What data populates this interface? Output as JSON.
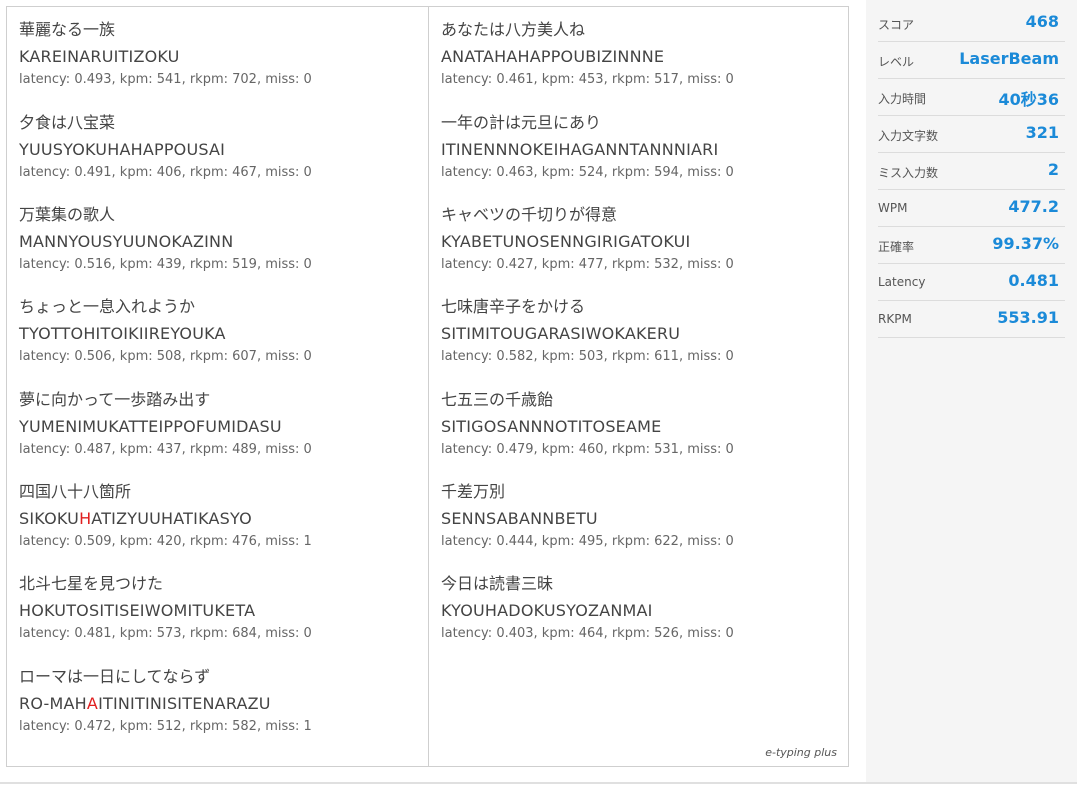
{
  "brand": "e-typing plus",
  "entries_left": [
    {
      "japanese": "華麗なる一族",
      "romaji": "KAREINARUITIZOKU",
      "stats": "latency: 0.493, kpm: 541, rkpm: 702, miss: 0"
    },
    {
      "japanese": "夕食は八宝菜",
      "romaji": "YUUSYOKUHAHAPPOUSAI",
      "stats": "latency: 0.491, kpm: 406, rkpm: 467, miss: 0"
    },
    {
      "japanese": "万葉集の歌人",
      "romaji": "MANNYOUSYUUNOKAZINN",
      "stats": "latency: 0.516, kpm: 439, rkpm: 519, miss: 0"
    },
    {
      "japanese": "ちょっと一息入れようか",
      "romaji": "TYOTTOHITOIKIIREYOUKA",
      "stats": "latency: 0.506, kpm: 508, rkpm: 607, miss: 0"
    },
    {
      "japanese": "夢に向かって一歩踏み出す",
      "romaji": "YUMENIMUKATTEIPPOFUMIDASU",
      "stats": "latency: 0.487, kpm: 437, rkpm: 489, miss: 0"
    },
    {
      "japanese": "四国八十八箇所",
      "romaji_pre": "SIKOKU",
      "romaji_miss": "H",
      "romaji_post": "ATIZYUUHATIKASYO",
      "stats": "latency: 0.509, kpm: 420, rkpm: 476, miss: 1"
    },
    {
      "japanese": "北斗七星を見つけた",
      "romaji": "HOKUTOSITISEIWOMITUKETA",
      "stats": "latency: 0.481, kpm: 573, rkpm: 684, miss: 0"
    },
    {
      "japanese": "ローマは一日にしてならず",
      "romaji_pre": "RO-MAH",
      "romaji_miss": "A",
      "romaji_post": "ITINITINISITENARAZU",
      "stats": "latency: 0.472, kpm: 512, rkpm: 582, miss: 1"
    }
  ],
  "entries_right": [
    {
      "japanese": "あなたは八方美人ね",
      "romaji": "ANATAHAHAPPOUBIZINNNE",
      "stats": "latency: 0.461, kpm: 453, rkpm: 517, miss: 0"
    },
    {
      "japanese": "一年の計は元旦にあり",
      "romaji": "ITINENNNOKEIHAGANNTANNNIARI",
      "stats": "latency: 0.463, kpm: 524, rkpm: 594, miss: 0"
    },
    {
      "japanese": "キャベツの千切りが得意",
      "romaji": "KYABETUNOSENNGIRIGATOKUI",
      "stats": "latency: 0.427, kpm: 477, rkpm: 532, miss: 0"
    },
    {
      "japanese": "七味唐辛子をかける",
      "romaji": "SITIMITOUGARASIWOKAKERU",
      "stats": "latency: 0.582, kpm: 503, rkpm: 611, miss: 0"
    },
    {
      "japanese": "七五三の千歳飴",
      "romaji": "SITIGOSANNNOTITOSEAME",
      "stats": "latency: 0.479, kpm: 460, rkpm: 531, miss: 0"
    },
    {
      "japanese": "千差万別",
      "romaji": "SENNSABANNBETU",
      "stats": "latency: 0.444, kpm: 495, rkpm: 622, miss: 0"
    },
    {
      "japanese": "今日は読書三昧",
      "romaji": "KYOUHADOKUSYOZANMAI",
      "stats": "latency: 0.403, kpm: 464, rkpm: 526, miss: 0"
    }
  ],
  "summary": [
    {
      "label": "スコア",
      "value": "468"
    },
    {
      "label": "レベル",
      "value": "LaserBeam"
    },
    {
      "label": "入力時間",
      "value": "40秒36"
    },
    {
      "label": "入力文字数",
      "value": "321"
    },
    {
      "label": "ミス入力数",
      "value": "2"
    },
    {
      "label": "WPM",
      "value": "477.2"
    },
    {
      "label": "正確率",
      "value": "99.37%"
    },
    {
      "label": "Latency",
      "value": "0.481"
    },
    {
      "label": "RKPM",
      "value": "553.91"
    }
  ],
  "colors": {
    "accent": "#1b8ad8",
    "miss": "#e02020"
  }
}
